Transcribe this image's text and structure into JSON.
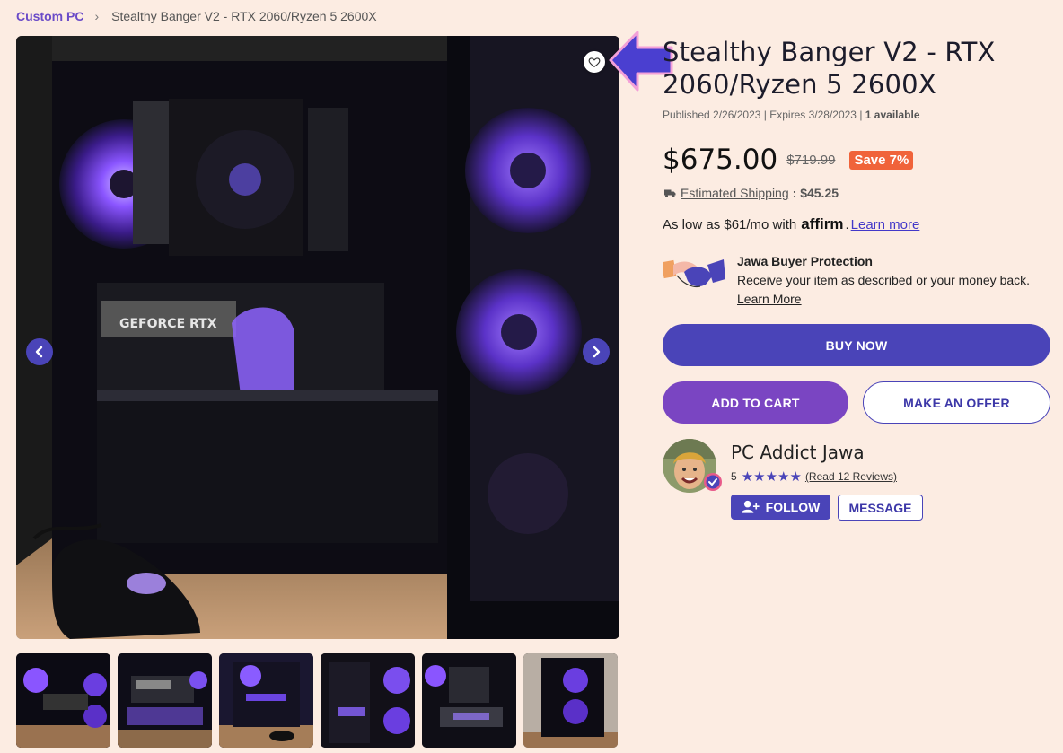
{
  "breadcrumb": {
    "category": "Custom PC",
    "separator": "›",
    "current": "Stealthy Banger V2 - RTX 2060/Ryzen 5 2600X"
  },
  "listing": {
    "title": "Stealthy Banger V2 - RTX 2060/Ryzen 5 2600X",
    "published": "Published 2/26/2023",
    "expires": "Expires 3/28/2023",
    "availability": "1 available",
    "meta_separator": "|"
  },
  "pricing": {
    "price": "$675.00",
    "original_price": "$719.99",
    "save_badge": "Save 7%",
    "shipping_label": "Estimated Shipping",
    "shipping_value": ": $45.25",
    "affirm_prefix": "As low as $61/mo with",
    "affirm_brand": "affirm",
    "affirm_link": "Learn more"
  },
  "protection": {
    "title": "Jawa Buyer Protection",
    "description": "Receive your item as described or your money back.",
    "link": "Learn More"
  },
  "actions": {
    "buy_now": "BUY NOW",
    "add_to_cart": "ADD TO CART",
    "make_offer": "MAKE AN OFFER"
  },
  "seller": {
    "name": "PC Addict Jawa",
    "rating": "5",
    "stars": "★★★★★",
    "reviews_link": "(Read 12 Reviews)",
    "follow": "FOLLOW",
    "message": "MESSAGE"
  },
  "gallery": {
    "thumbnail_count": 6
  },
  "colors": {
    "background": "#fcece2",
    "brand_blue": "#4a44b8",
    "brand_purple": "#7a45c2",
    "save_orange": "#f0633a",
    "breadcrumb_link": "#6a4bc8"
  },
  "icons": [
    "heart-icon",
    "chevron-left-icon",
    "chevron-right-icon",
    "truck-icon",
    "handshake-icon",
    "verified-badge-icon",
    "user-plus-icon",
    "pointer-arrow-icon"
  ]
}
